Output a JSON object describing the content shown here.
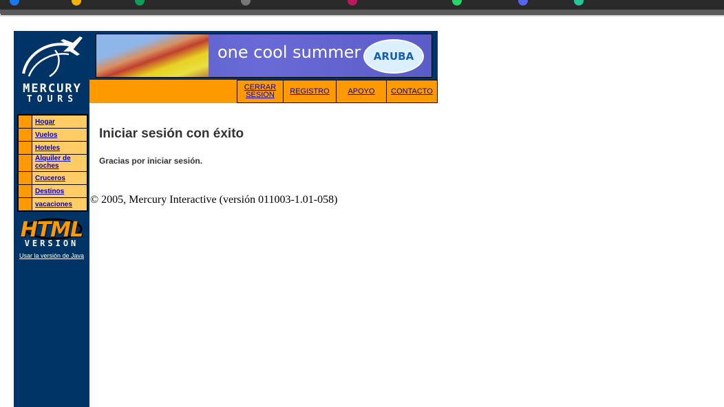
{
  "logo": {
    "line1": "MERCURY",
    "line2": "TOURS"
  },
  "banner": {
    "slogan": "one cool summer",
    "brand": "ARUBA"
  },
  "top_nav": [
    {
      "label": "CERRAR SESIÓN"
    },
    {
      "label": "REGISTRO"
    },
    {
      "label": "APOYO"
    },
    {
      "label": "CONTACTO"
    }
  ],
  "side_nav": [
    {
      "label": "Hogar"
    },
    {
      "label": "Vuelos"
    },
    {
      "label": "Hoteles"
    },
    {
      "label": "Alquiler de coches"
    },
    {
      "label": "Cruceros"
    },
    {
      "label": "Destinos"
    },
    {
      "label": "vacaciones"
    }
  ],
  "html_badge": {
    "title": "HTML",
    "subtitle": "VERSION"
  },
  "java_link": "Usar la versión de Java",
  "main": {
    "title": "Iniciar sesión con éxito",
    "message": "Gracias por iniciar sesión."
  },
  "footer": "© 2005, Mercury Interactive (versión 011003-1.01-058)",
  "colors": {
    "sidebar": "#003366",
    "accent": "#ff9900",
    "nav_cell": "#ffcc66",
    "link": "#0000cc"
  }
}
